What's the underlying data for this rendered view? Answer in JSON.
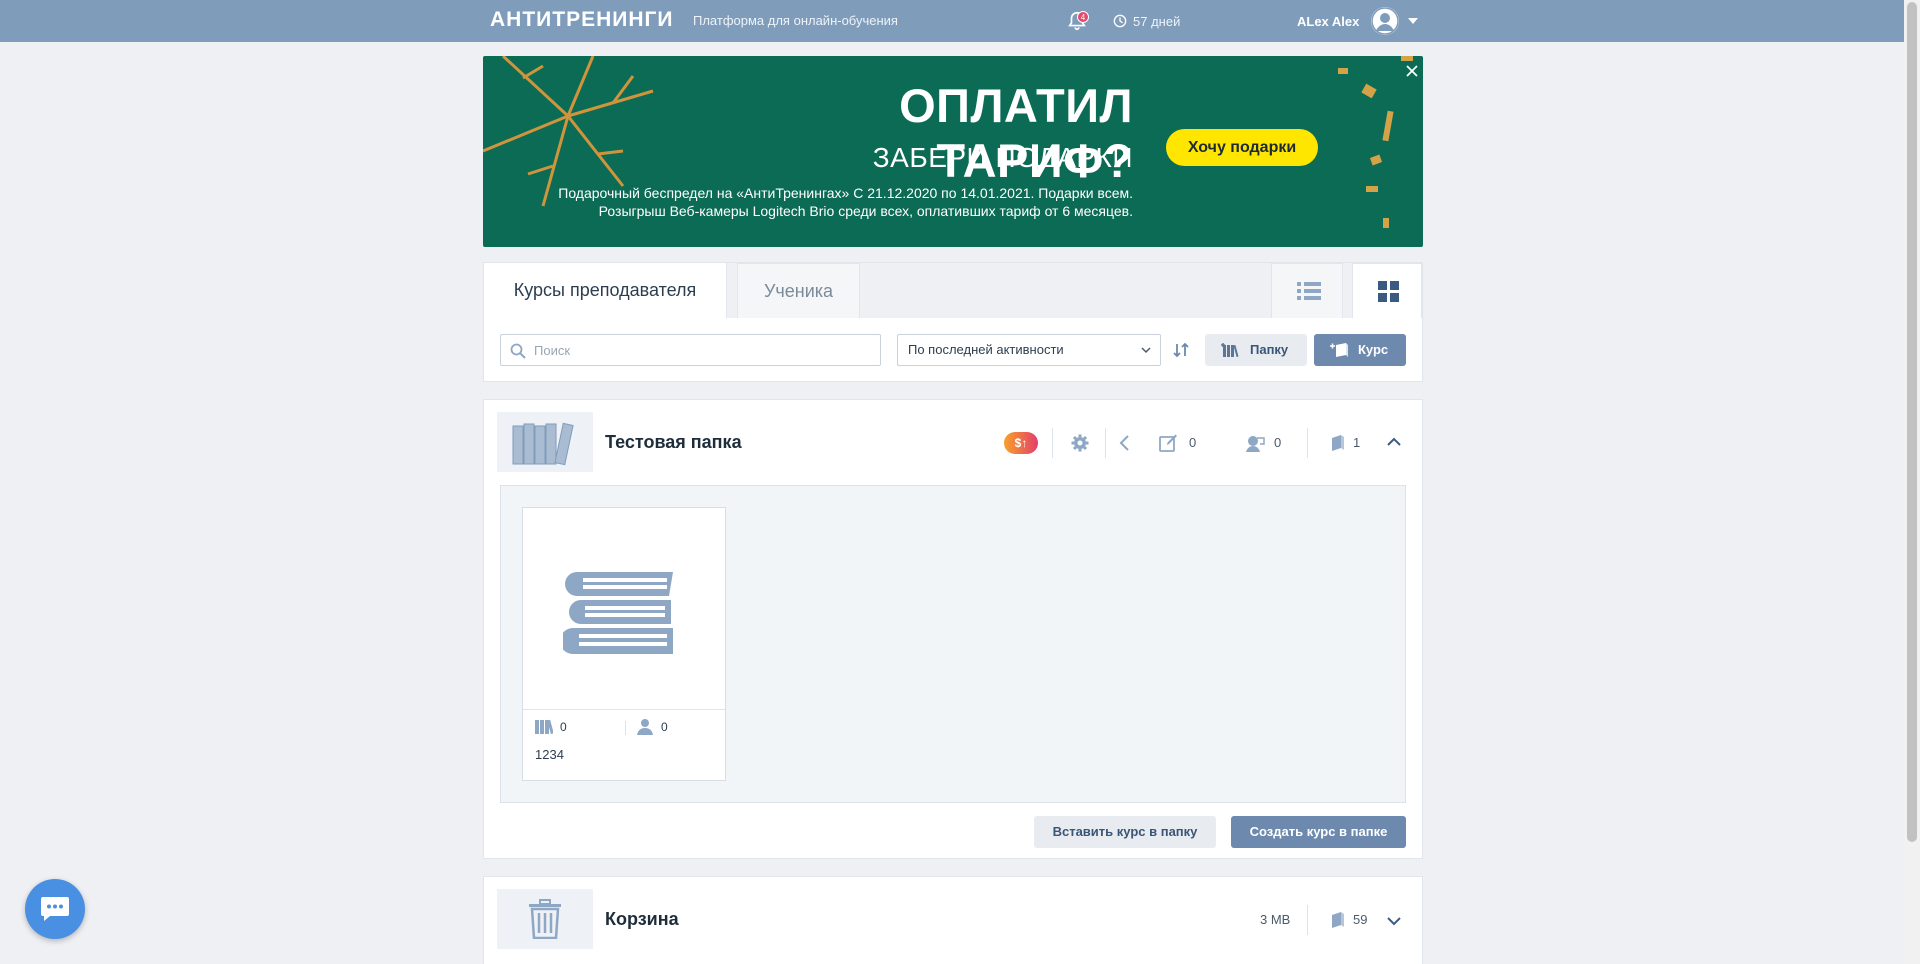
{
  "header": {
    "logo": "АНТИТРЕНИНГИ",
    "tagline": "Платформа для онлайн-обучения",
    "notification_count": "4",
    "days_left": "57 дней",
    "user_name": "ALex Alex"
  },
  "banner": {
    "headline": "ОПЛАТИЛ ТАРИФ?",
    "subhead": "ЗАБЕРИ ПОДАРКИ",
    "body_line1": "Подарочный беспредел на «АнтиТренингах» С 21.12.2020 по 14.01.2021. Подарки всем.",
    "body_line2": "Розыгрыш Веб-камеры Logitech Brio среди всех, оплативших тариф от 6 месяцев.",
    "cta": "Хочу подарки",
    "colors": {
      "background": "#0b6b54",
      "cta": "#ffe600"
    }
  },
  "tabs": {
    "teacher": "Курсы преподавателя",
    "student": "Ученика",
    "active": "teacher"
  },
  "toolbar": {
    "search_placeholder": "Поиск",
    "search_value": "",
    "sort_value": "По последней активности",
    "folder_button": "Папку",
    "course_button": "Курс"
  },
  "folder": {
    "title": "Тестовая папка",
    "badge": "$↑",
    "edit_count": "0",
    "students_count": "0",
    "courses_count": "1",
    "insert_button": "Вставить курс в папку",
    "create_button": "Создать курс в папке",
    "courses": [
      {
        "name": "1234",
        "lessons": "0",
        "students": "0"
      }
    ]
  },
  "trash": {
    "title": "Корзина",
    "size": "3 MB",
    "courses_count": "59"
  },
  "colors": {
    "topbar": "#7f9cbb",
    "primary_button": "#6d89ad",
    "icon": "#8ea7c4"
  }
}
